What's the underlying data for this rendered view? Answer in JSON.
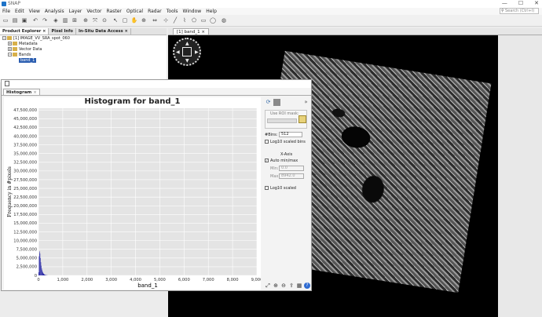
{
  "app": {
    "title": "SNAP"
  },
  "window_controls": {
    "minimize": "—",
    "maximize": "☐",
    "close": "✕"
  },
  "menu": [
    "File",
    "Edit",
    "View",
    "Analysis",
    "Layer",
    "Vector",
    "Raster",
    "Optical",
    "Radar",
    "Tools",
    "Window",
    "Help"
  ],
  "search": {
    "placeholder": "Search (Ctrl+I)"
  },
  "panel_tabs": [
    {
      "label": "Product Explorer",
      "close": "×"
    },
    {
      "label": "Pixel Info"
    },
    {
      "label": "In-Situ Data Access",
      "close": "×"
    }
  ],
  "tree": {
    "product": "[1] IMAGE_VV_SRA_spot_060",
    "metadata": "Metadata",
    "vector": "Vector Data",
    "bands": "Bands",
    "band": "band_1"
  },
  "view_tab": {
    "label": "[1] band_1",
    "close": "×"
  },
  "hist_tab": {
    "label": "Histogram",
    "close": "×"
  },
  "histogram_panel": {
    "use_roi_mask": "Use ROI mask:",
    "bins_label": "#Bins:",
    "bins_value": "512",
    "log_bins": "Log10 scaled bins",
    "xaxis_section": "X-Axis",
    "auto_minmax": "Auto min/max",
    "min_label": "Min:",
    "min_value": "0.0",
    "max_label": "Max:",
    "max_value": "8942.0",
    "log_scaled": "Log10 scaled"
  },
  "chart_data": {
    "type": "bar",
    "title": "Histogram for band_1",
    "xlabel": "band_1",
    "ylabel": "Frequency in #pixels",
    "xlim": [
      0,
      9000
    ],
    "ylim": [
      0,
      48000000
    ],
    "x_ticks": [
      "0",
      "1,000",
      "2,000",
      "3,000",
      "4,000",
      "5,000",
      "6,000",
      "7,000",
      "8,000",
      "9,000"
    ],
    "y_ticks": [
      "0",
      "2,500,000",
      "5,000,000",
      "7,500,000",
      "10,000,000",
      "12,500,000",
      "15,000,000",
      "17,500,000",
      "20,000,000",
      "22,500,000",
      "25,000,000",
      "27,500,000",
      "30,000,000",
      "32,500,000",
      "35,000,000",
      "37,500,000",
      "40,000,000",
      "42,500,000",
      "45,000,000",
      "47,500,000"
    ],
    "x": [
      0,
      17,
      35,
      52,
      70,
      87,
      105,
      122,
      140,
      157,
      175,
      192,
      210,
      227,
      245,
      262,
      280,
      300,
      320,
      350
    ],
    "values": [
      900000,
      5500000,
      6900000,
      6300000,
      5000000,
      3800000,
      2800000,
      2000000,
      1500000,
      1100000,
      800000,
      600000,
      450000,
      330000,
      250000,
      180000,
      130000,
      90000,
      60000,
      30000
    ],
    "bar_color": "#2b2ba8",
    "grid": true,
    "legend": "none"
  }
}
